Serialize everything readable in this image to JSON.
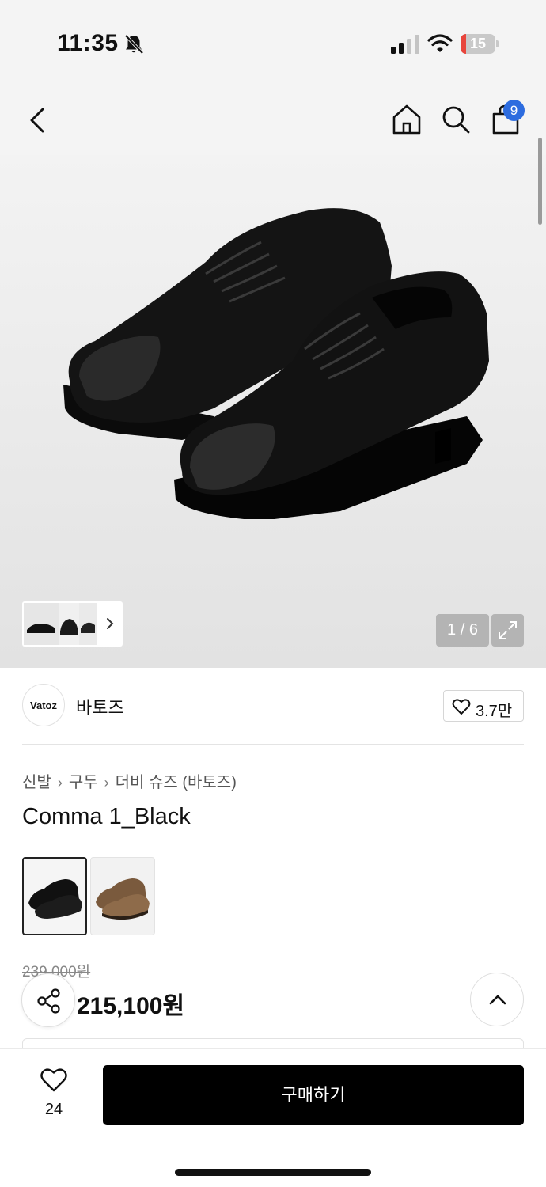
{
  "status_bar": {
    "time": "11:35",
    "battery_level": "15",
    "icons": [
      "bell-slash-icon",
      "signal-icon",
      "wifi-icon",
      "battery-icon"
    ]
  },
  "nav": {
    "icons": [
      "back-icon",
      "home-icon",
      "search-icon",
      "shopping-bag-icon"
    ],
    "cart_count": "9"
  },
  "gallery": {
    "counter": "1 / 6",
    "thumbnail_icon": "chevron-right-icon",
    "expand_icon": "expand-icon"
  },
  "brand": {
    "logo_text": "Vatoz",
    "name": "바토즈",
    "likes": "3.7만"
  },
  "breadcrumb": {
    "items": [
      "신발",
      "구두",
      "더비 슈즈 (바토즈)"
    ],
    "separator": "›"
  },
  "product": {
    "title": "Comma 1_Black",
    "colors": [
      "Black",
      "Brown"
    ],
    "original_price": "239,000원",
    "price": "215,100원"
  },
  "footer": {
    "wish_count": "24",
    "buy_label": "구매하기"
  },
  "colors": {
    "badge": "#2d6cdf",
    "battery_low": "#e8453c",
    "primary_button": "#000000"
  }
}
